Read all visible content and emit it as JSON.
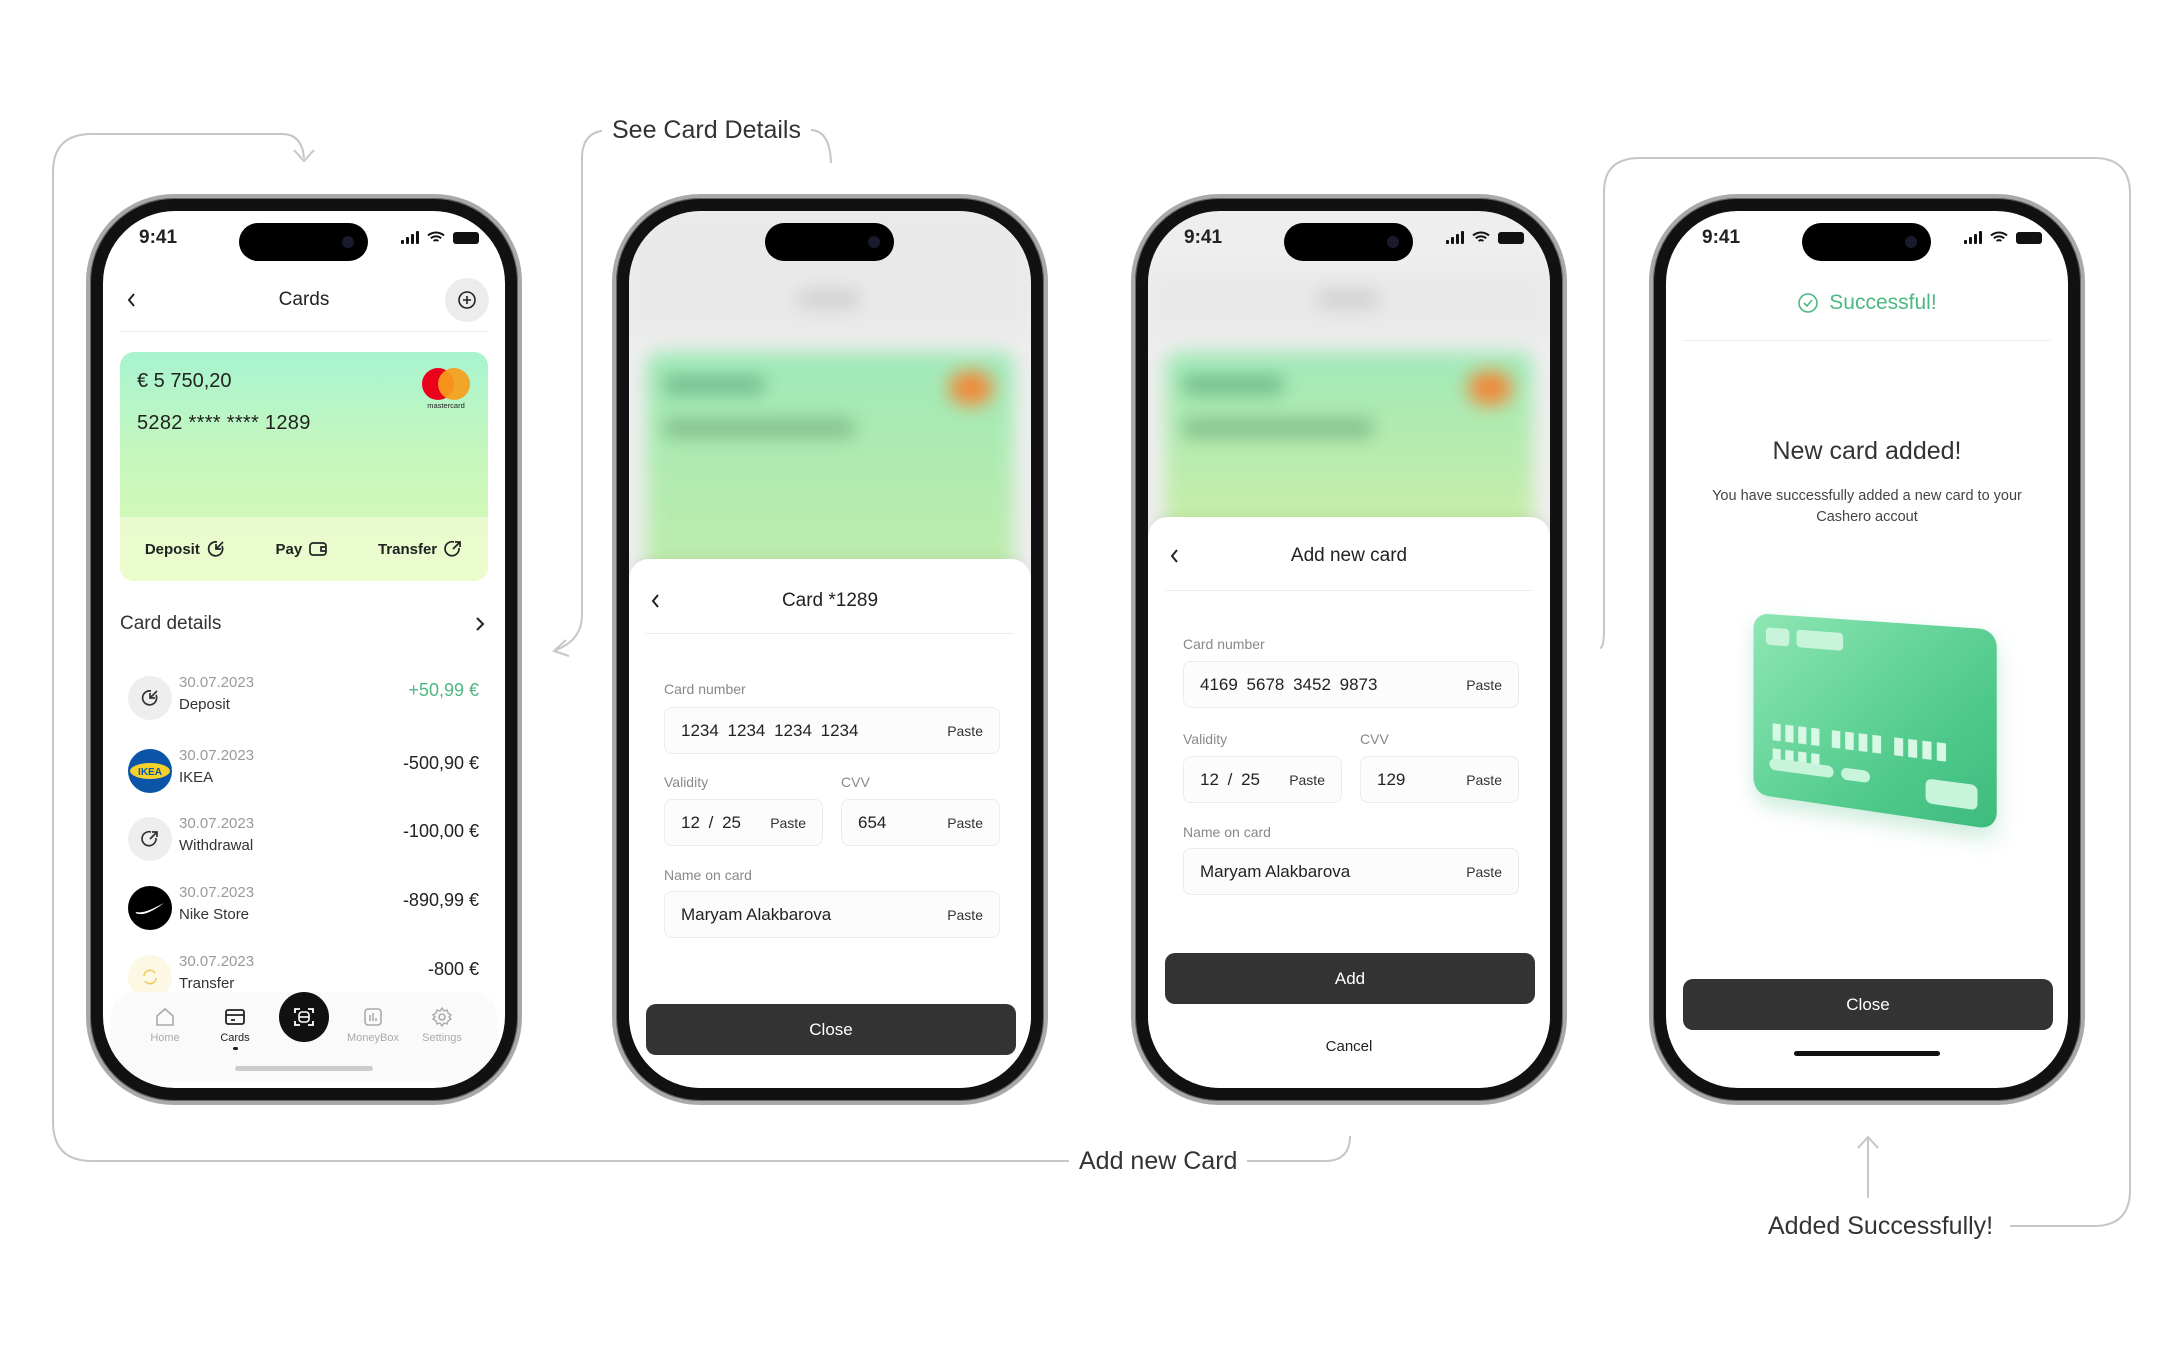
{
  "annotations": {
    "see_card_details": "See Card Details",
    "add_new_card": "Add new Card",
    "added_successfully": "Added Successfully!"
  },
  "colors": {
    "accent_green": "#4cb882",
    "button_dark": "#333333",
    "card_gradient_top": "#a8f4d0",
    "card_gradient_bottom": "#dcf9b3"
  },
  "status_bar": {
    "time": "9:41"
  },
  "screen_cards": {
    "title": "Cards",
    "card": {
      "balance": "€ 5 750,20",
      "number": "5282 **** **** 1289",
      "brand": "mastercard"
    },
    "actions": [
      {
        "label": "Deposit",
        "icon": "deposit-arrow-icon"
      },
      {
        "label": "Pay",
        "icon": "wallet-icon"
      },
      {
        "label": "Transfer",
        "icon": "transfer-arrow-icon"
      }
    ],
    "card_details_label": "Card details",
    "transactions": [
      {
        "date": "30.07.2023",
        "name": "Deposit",
        "amount": "+50,99 €",
        "positive": true,
        "icon": "deposit-icon"
      },
      {
        "date": "30.07.2023",
        "name": "IKEA",
        "amount": "-500,90 €",
        "positive": false,
        "icon": "ikea-logo"
      },
      {
        "date": "30.07.2023",
        "name": "Withdrawal",
        "amount": "-100,00 €",
        "positive": false,
        "icon": "withdrawal-icon"
      },
      {
        "date": "30.07.2023",
        "name": "Nike Store",
        "amount": "-890,99 €",
        "positive": false,
        "icon": "nike-logo"
      },
      {
        "date": "30.07.2023",
        "name": "Transfer",
        "amount": "-800 €",
        "positive": false,
        "icon": "refresh-icon"
      }
    ],
    "nav": [
      {
        "label": "Home",
        "active": false
      },
      {
        "label": "Cards",
        "active": true
      },
      {
        "label": "Scan",
        "active": false
      },
      {
        "label": "MoneyBox",
        "active": false
      },
      {
        "label": "Settings",
        "active": false
      }
    ]
  },
  "screen_card_detail": {
    "title": "Card *1289",
    "card_number_label": "Card number",
    "card_number": "1234  1234  1234  1234",
    "validity_label": "Validity",
    "validity": "12  /  25",
    "cvv_label": "CVV",
    "cvv": "654",
    "name_label": "Name on card",
    "name": "Maryam Alakbarova",
    "paste": "Paste",
    "close": "Close"
  },
  "screen_add_card": {
    "title": "Add new card",
    "card_number_label": "Card number",
    "card_number": "4169  5678  3452  9873",
    "validity_label": "Validity",
    "validity": "12  /  25",
    "cvv_label": "CVV",
    "cvv": "129",
    "name_label": "Name on card",
    "name": "Maryam Alakbarova",
    "paste": "Paste",
    "add": "Add",
    "cancel": "Cancel"
  },
  "screen_success": {
    "status": "Successful!",
    "title": "New card added!",
    "desc_line1": "You have successfully added a new card to your",
    "desc_line2": "Cashero accout",
    "close": "Close"
  }
}
